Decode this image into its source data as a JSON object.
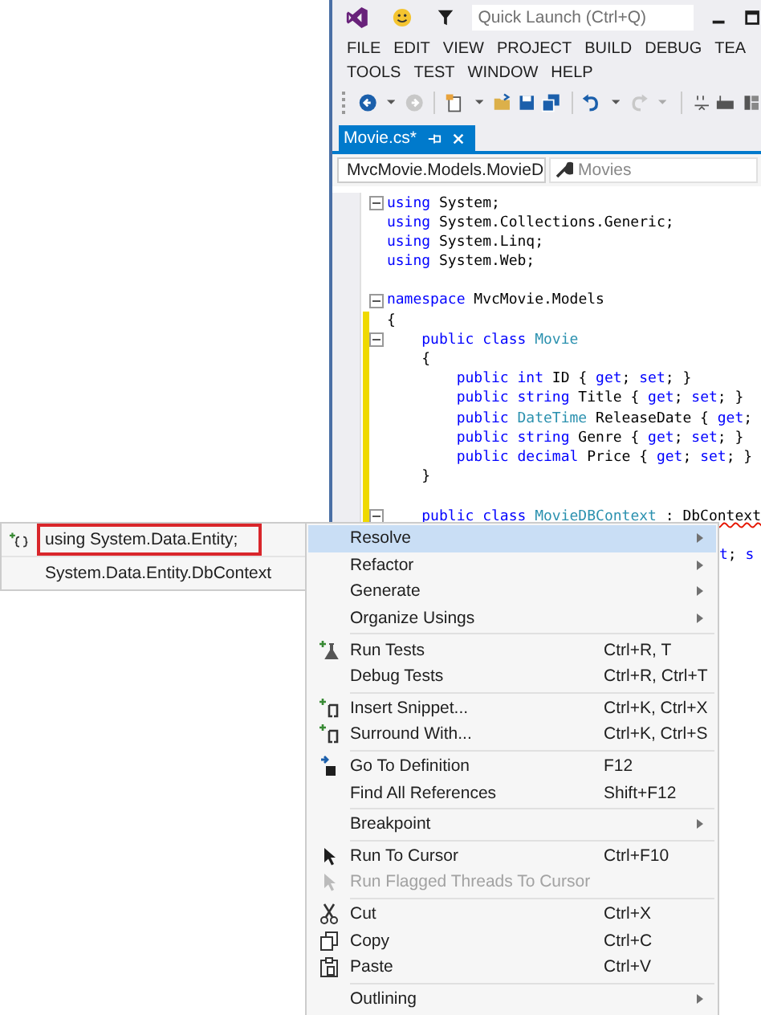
{
  "title_bar": {
    "quick_launch": {
      "placeholder": "Quick Launch (Ctrl+Q)"
    }
  },
  "menu_rows": [
    [
      "FILE",
      "EDIT",
      "VIEW",
      "PROJECT",
      "BUILD",
      "DEBUG",
      "TEA"
    ],
    [
      "TOOLS",
      "TEST",
      "WINDOW",
      "HELP"
    ]
  ],
  "tab": {
    "label": "Movie.cs*"
  },
  "nav_bar": {
    "type_dropdown": "MvcMovie.Models.MovieD",
    "member_dropdown": "Movies"
  },
  "code_lines": [
    {
      "kind": "code",
      "fold": true,
      "changed": false,
      "tokens": [
        {
          "kind": "kw",
          "text": "using"
        },
        {
          "kind": "plain",
          "text": " System;"
        }
      ]
    },
    {
      "kind": "code",
      "fold": false,
      "changed": false,
      "tokens": [
        {
          "kind": "kw",
          "text": "using"
        },
        {
          "kind": "plain",
          "text": " System.Collections.Generic;"
        }
      ]
    },
    {
      "kind": "code",
      "fold": false,
      "changed": false,
      "tokens": [
        {
          "kind": "kw",
          "text": "using"
        },
        {
          "kind": "plain",
          "text": " System.Linq;"
        }
      ]
    },
    {
      "kind": "code",
      "fold": false,
      "changed": false,
      "tokens": [
        {
          "kind": "kw",
          "text": "using"
        },
        {
          "kind": "plain",
          "text": " System.Web;"
        }
      ]
    },
    {
      "kind": "blank",
      "fold": false,
      "changed": false
    },
    {
      "kind": "code",
      "fold": true,
      "changed": false,
      "tokens": [
        {
          "kind": "kw",
          "text": "namespace"
        },
        {
          "kind": "plain",
          "text": " MvcMovie.Models"
        }
      ]
    },
    {
      "kind": "code",
      "fold": false,
      "changed": true,
      "tokens": [
        {
          "kind": "plain",
          "text": "{"
        }
      ]
    },
    {
      "kind": "code",
      "fold": true,
      "changed": true,
      "tokens": [
        {
          "kind": "kw",
          "text": "    public class "
        },
        {
          "kind": "type",
          "text": "Movie"
        }
      ]
    },
    {
      "kind": "code",
      "fold": false,
      "changed": true,
      "tokens": [
        {
          "kind": "plain",
          "text": "    {"
        }
      ]
    },
    {
      "kind": "code",
      "fold": false,
      "changed": true,
      "tokens": [
        {
          "kind": "kw",
          "text": "        public int"
        },
        {
          "kind": "plain",
          "text": " ID { "
        },
        {
          "kind": "kw",
          "text": "get"
        },
        {
          "kind": "plain",
          "text": "; "
        },
        {
          "kind": "kw",
          "text": "set"
        },
        {
          "kind": "plain",
          "text": "; }"
        }
      ]
    },
    {
      "kind": "code",
      "fold": false,
      "changed": true,
      "tokens": [
        {
          "kind": "kw",
          "text": "        public string"
        },
        {
          "kind": "plain",
          "text": " Title { "
        },
        {
          "kind": "kw",
          "text": "get"
        },
        {
          "kind": "plain",
          "text": "; "
        },
        {
          "kind": "kw",
          "text": "set"
        },
        {
          "kind": "plain",
          "text": "; }"
        }
      ]
    },
    {
      "kind": "code",
      "fold": false,
      "changed": true,
      "tokens": [
        {
          "kind": "kw",
          "text": "        public "
        },
        {
          "kind": "type",
          "text": "DateTime"
        },
        {
          "kind": "plain",
          "text": " ReleaseDate { "
        },
        {
          "kind": "kw",
          "text": "get"
        },
        {
          "kind": "plain",
          "text": ";"
        }
      ]
    },
    {
      "kind": "code",
      "fold": false,
      "changed": true,
      "tokens": [
        {
          "kind": "kw",
          "text": "        public string"
        },
        {
          "kind": "plain",
          "text": " Genre { "
        },
        {
          "kind": "kw",
          "text": "get"
        },
        {
          "kind": "plain",
          "text": "; "
        },
        {
          "kind": "kw",
          "text": "set"
        },
        {
          "kind": "plain",
          "text": "; }"
        }
      ]
    },
    {
      "kind": "code",
      "fold": false,
      "changed": true,
      "tokens": [
        {
          "kind": "kw",
          "text": "        public decimal"
        },
        {
          "kind": "plain",
          "text": " Price { "
        },
        {
          "kind": "kw",
          "text": "get"
        },
        {
          "kind": "plain",
          "text": "; "
        },
        {
          "kind": "kw",
          "text": "set"
        },
        {
          "kind": "plain",
          "text": "; }"
        }
      ]
    },
    {
      "kind": "code",
      "fold": false,
      "changed": true,
      "tokens": [
        {
          "kind": "plain",
          "text": "    }"
        }
      ]
    },
    {
      "kind": "blank",
      "fold": false,
      "changed": true
    },
    {
      "kind": "code",
      "fold": true,
      "changed": true,
      "tokens": [
        {
          "kind": "kw",
          "text": "    public class "
        },
        {
          "kind": "type",
          "text": "MovieDBContext"
        },
        {
          "kind": "plain",
          "text": " : "
        },
        {
          "kind": "error",
          "text": "DbContext"
        }
      ]
    },
    {
      "kind": "tail",
      "tokens": [
        {
          "kind": "kw",
          "text": "t"
        },
        {
          "kind": "plain",
          "text": "; "
        },
        {
          "kind": "kw",
          "text": "s"
        }
      ]
    }
  ],
  "quick_actions": [
    {
      "label": "using System.Data.Entity;",
      "selected": true
    },
    {
      "label": "System.Data.Entity.DbContext",
      "selected": false
    }
  ],
  "context_menu": [
    {
      "label": "Resolve",
      "submenu": true,
      "selected": true,
      "disabled": false,
      "separator_before": false
    },
    {
      "label": "Refactor",
      "submenu": true,
      "selected": false,
      "disabled": false,
      "separator_before": false
    },
    {
      "label": "Generate",
      "submenu": true,
      "selected": false,
      "disabled": false,
      "separator_before": false
    },
    {
      "label": "Organize Usings",
      "submenu": true,
      "selected": false,
      "disabled": false,
      "separator_before": false
    },
    {
      "label": "Run Tests",
      "shortcut": "Ctrl+R, T",
      "submenu": false,
      "selected": false,
      "disabled": false,
      "separator_before": true
    },
    {
      "label": "Debug Tests",
      "shortcut": "Ctrl+R, Ctrl+T",
      "submenu": false,
      "selected": false,
      "disabled": false,
      "separator_before": false
    },
    {
      "label": "Insert Snippet...",
      "shortcut": "Ctrl+K, Ctrl+X",
      "submenu": false,
      "selected": false,
      "disabled": false,
      "separator_before": true
    },
    {
      "label": "Surround With...",
      "shortcut": "Ctrl+K, Ctrl+S",
      "submenu": false,
      "selected": false,
      "disabled": false,
      "separator_before": false
    },
    {
      "label": "Go To Definition",
      "shortcut": "F12",
      "submenu": false,
      "selected": false,
      "disabled": false,
      "separator_before": true
    },
    {
      "label": "Find All References",
      "shortcut": "Shift+F12",
      "submenu": false,
      "selected": false,
      "disabled": false,
      "separator_before": false
    },
    {
      "label": "Breakpoint",
      "submenu": true,
      "selected": false,
      "disabled": false,
      "separator_before": true
    },
    {
      "label": "Run To Cursor",
      "shortcut": "Ctrl+F10",
      "submenu": false,
      "selected": false,
      "disabled": false,
      "separator_before": true
    },
    {
      "label": "Run Flagged Threads To Cursor",
      "submenu": false,
      "selected": false,
      "disabled": true,
      "separator_before": false
    },
    {
      "label": "Cut",
      "shortcut": "Ctrl+X",
      "submenu": false,
      "selected": false,
      "disabled": false,
      "separator_before": true
    },
    {
      "label": "Copy",
      "shortcut": "Ctrl+C",
      "submenu": false,
      "selected": false,
      "disabled": false,
      "separator_before": false
    },
    {
      "label": "Paste",
      "shortcut": "Ctrl+V",
      "submenu": false,
      "selected": false,
      "disabled": false,
      "separator_before": false
    },
    {
      "label": "Outlining",
      "submenu": true,
      "selected": false,
      "disabled": false,
      "separator_before": true
    }
  ]
}
